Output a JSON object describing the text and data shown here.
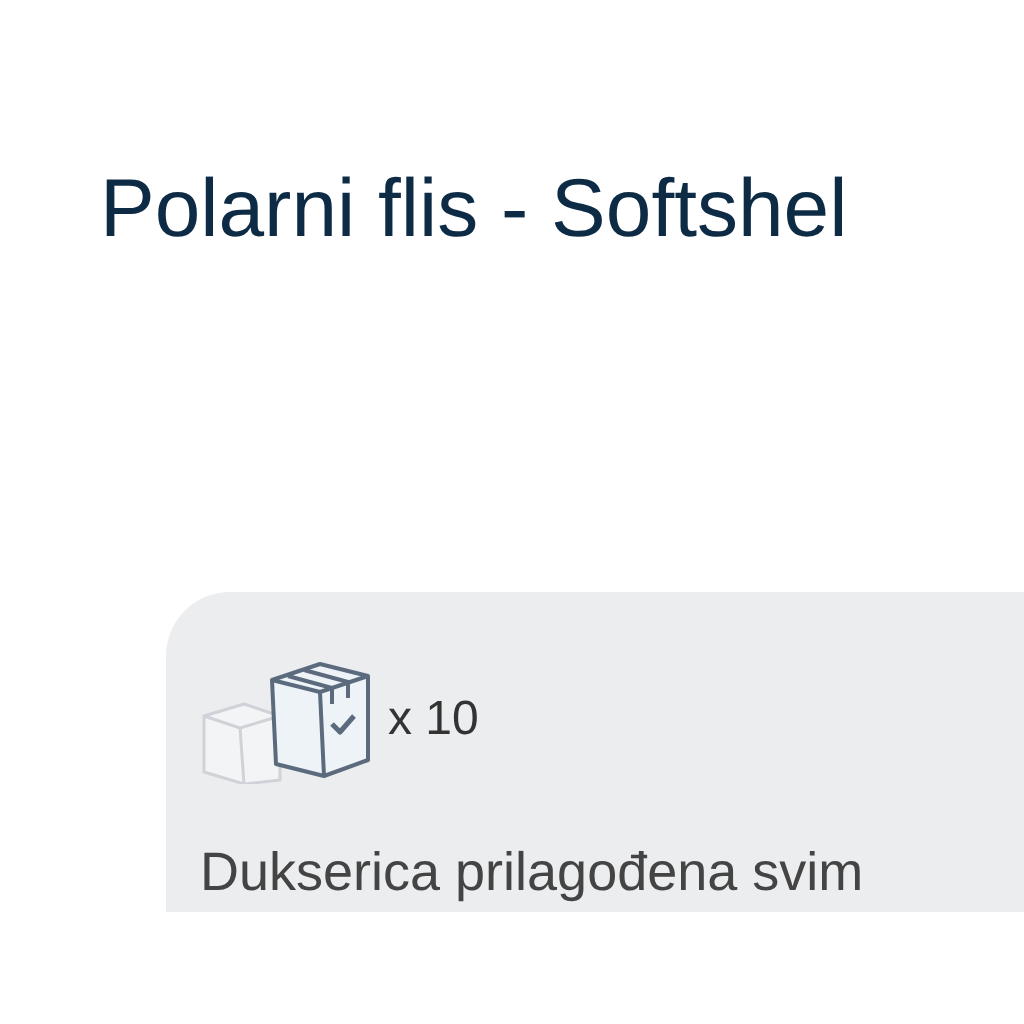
{
  "title": "Polarni flis - Softshel",
  "card": {
    "quantity": "x 10",
    "description": "Dukserica prilagođena svim"
  }
}
